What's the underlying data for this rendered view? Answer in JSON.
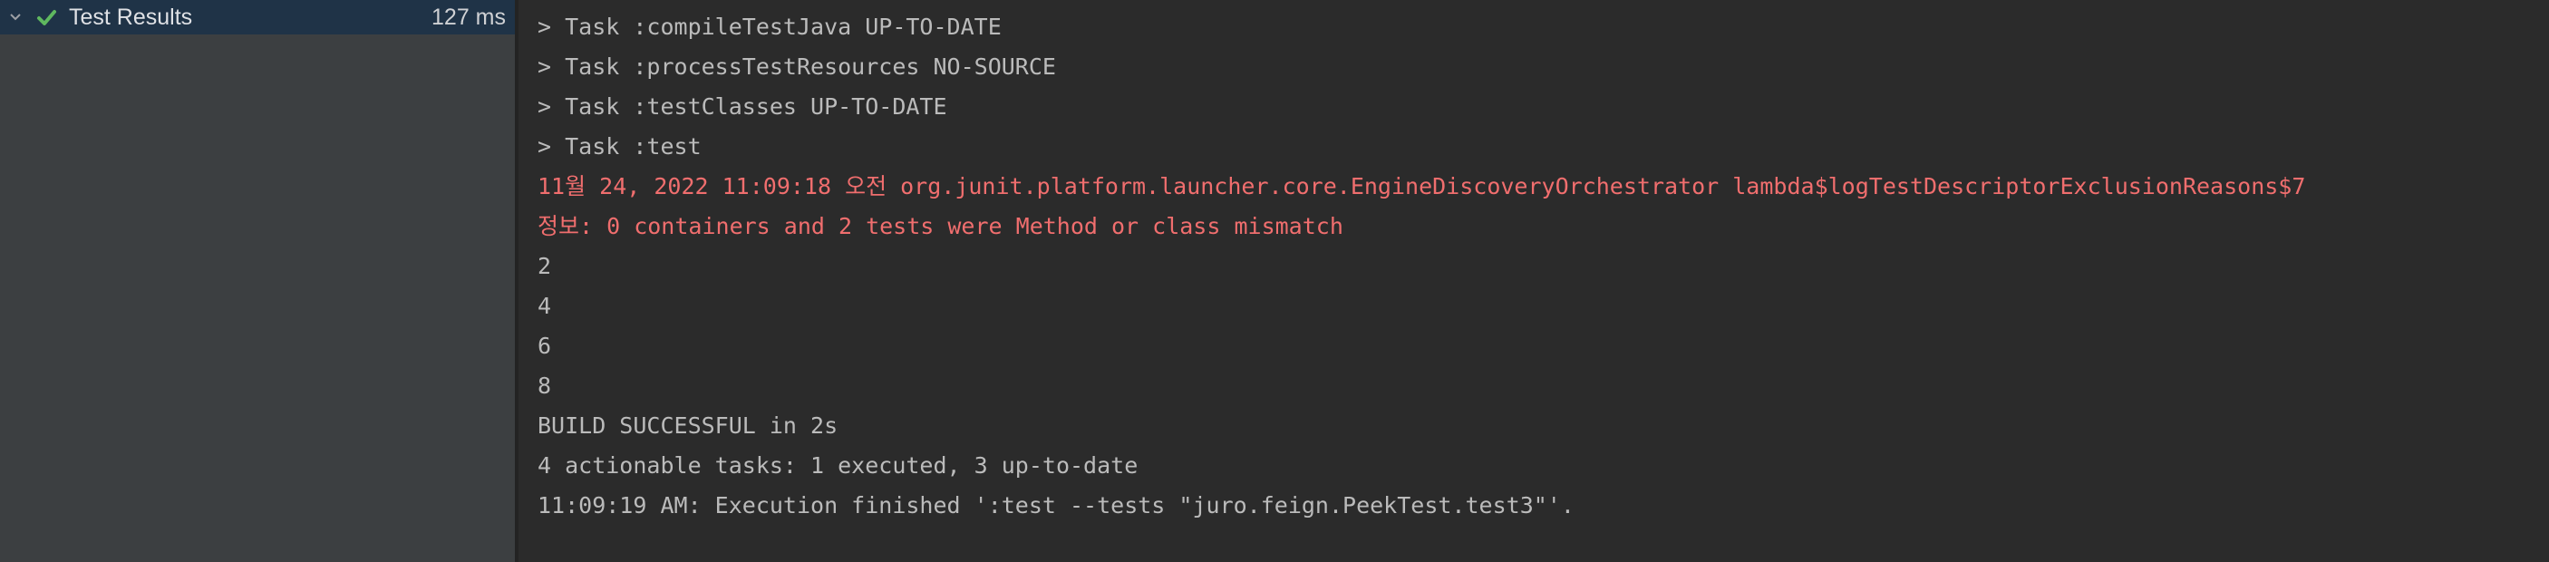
{
  "tree": {
    "root_label": "Test Results",
    "root_time": "127 ms",
    "status_icon": "check-icon",
    "expand_icon": "chevron-down-icon",
    "colors": {
      "selected_row": "#1f3347",
      "pass_green": "#5fb85f"
    }
  },
  "console": {
    "lines": [
      {
        "text": "> Task :compileTestJava UP-TO-DATE",
        "kind": "normal"
      },
      {
        "text": "> Task :processTestResources NO-SOURCE",
        "kind": "normal"
      },
      {
        "text": "> Task :testClasses UP-TO-DATE",
        "kind": "normal"
      },
      {
        "text": "> Task :test",
        "kind": "normal"
      },
      {
        "text": "11월 24, 2022 11:09:18 오전 org.junit.platform.launcher.core.EngineDiscoveryOrchestrator lambda$logTestDescriptorExclusionReasons$7",
        "kind": "error"
      },
      {
        "text": "정보: 0 containers and 2 tests were Method or class mismatch",
        "kind": "error"
      },
      {
        "text": "2",
        "kind": "normal"
      },
      {
        "text": "4",
        "kind": "normal"
      },
      {
        "text": "6",
        "kind": "normal"
      },
      {
        "text": "8",
        "kind": "normal"
      },
      {
        "text": "BUILD SUCCESSFUL in 2s",
        "kind": "normal"
      },
      {
        "text": "4 actionable tasks: 1 executed, 3 up-to-date",
        "kind": "normal"
      },
      {
        "text": "11:09:19 AM: Execution finished ':test --tests \"juro.feign.PeekTest.test3\"'.",
        "kind": "normal"
      }
    ],
    "colors": {
      "normal_text": "#bbbbbb",
      "error_text": "#f06e6e"
    }
  }
}
